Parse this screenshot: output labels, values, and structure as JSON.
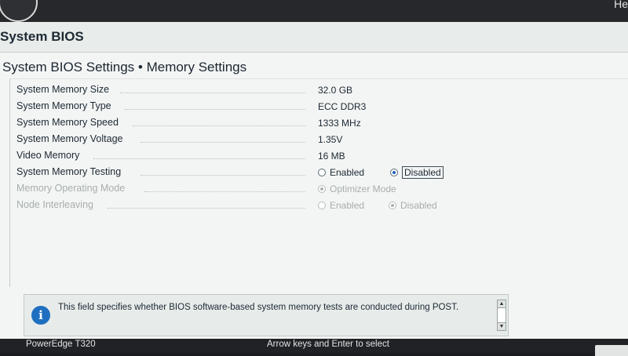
{
  "header": {
    "help_label": "He"
  },
  "screen": {
    "title": "System BIOS",
    "subtitle": "System BIOS Settings • Memory Settings"
  },
  "settings": [
    {
      "label": "System Memory Size",
      "value": "32.0 GB"
    },
    {
      "label": "System Memory Type",
      "value": "ECC DDR3"
    },
    {
      "label": "System Memory Speed",
      "value": "1333 MHz"
    },
    {
      "label": "System Memory Voltage",
      "value": "1.35V"
    },
    {
      "label": "Video Memory",
      "value": "16 MB"
    },
    {
      "label": "System Memory Testing",
      "options": [
        "Enabled",
        "Disabled"
      ],
      "selected": "Disabled"
    },
    {
      "label": "Memory Operating Mode",
      "options": [
        "Optimizer Mode"
      ],
      "selected": "Optimizer Mode",
      "disabled": true
    },
    {
      "label": "Node Interleaving",
      "options": [
        "Enabled",
        "Disabled"
      ],
      "selected": "Disabled",
      "disabled": true
    }
  ],
  "help": {
    "text": "This field specifies whether BIOS software-based system memory tests are conducted during POST."
  },
  "status": {
    "model": "PowerEdge T320",
    "hint": "Arrow keys and Enter to select"
  },
  "colors": {
    "accent": "#1f5fbf",
    "info": "#1f6fc0"
  },
  "icons": {
    "info": "info-icon",
    "scroll_up": "arrow-up-icon",
    "scroll_down": "arrow-down-icon"
  }
}
